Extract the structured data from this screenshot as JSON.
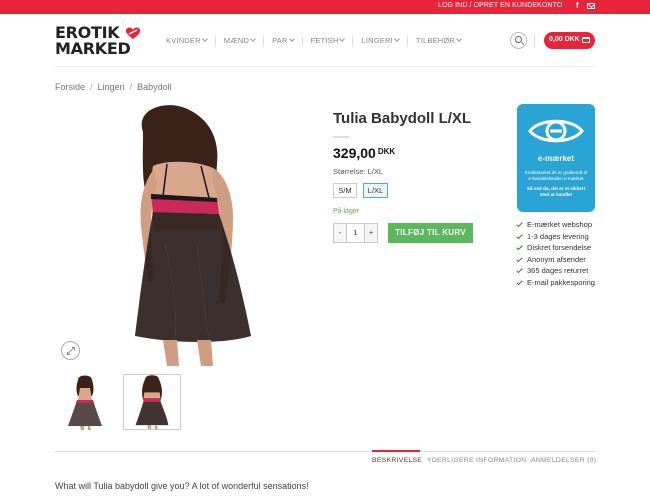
{
  "topbar": {
    "login_label": "LOG IND / OPRET EN KUNDEKONTO",
    "facebook_icon": "facebook-icon",
    "mail_icon": "mail-icon"
  },
  "header": {
    "logo_line1": "EROTIK",
    "logo_line2": "MARKED",
    "nav": [
      {
        "label": "KVINDER"
      },
      {
        "label": "MÆND"
      },
      {
        "label": "PAR"
      },
      {
        "label": "FETISH"
      },
      {
        "label": "LINGERI"
      },
      {
        "label": "TILBEHØR"
      }
    ],
    "cart_label": "0,00 DKK"
  },
  "breadcrumb": [
    "Forside",
    "Lingeri",
    "Babydoll"
  ],
  "product": {
    "title": "Tulia Babydoll L/XL",
    "price": "329,00",
    "currency": "DKK",
    "size_label": "Størrelse: L/XL",
    "sizes": [
      "S/M",
      "L/XL"
    ],
    "selected_size": "L/XL",
    "stock": "På lager",
    "qty_minus": "-",
    "quantity": "1",
    "qty_plus": "+",
    "add_to_cart": "TILFØJ TIL KURV"
  },
  "emarket": {
    "brand": "e-mærket",
    "desc": "ErotikMarket.dk er godkendt af e-handelsfonden e-mærket",
    "desc2": "Så ved du, det er et sikkert sted at handle!"
  },
  "features": [
    "E-mærket webshop",
    "1-3 dages levering",
    "Diskret forsendelse",
    "Anonym afsender",
    "365 dages returret",
    "E-mail pakkesporing"
  ],
  "tabs": [
    "BESKRIVELSE",
    "YDERLIGERE INFORMATION",
    "ANMELDELSER (0)"
  ],
  "description": "What will Tulia babydoll give you? A lot of wonderful sensations!",
  "colors": {
    "brand_red": "#e8243a",
    "cart_green": "#5cb85c",
    "emarket_blue": "#2aa4d4",
    "stock_green": "#6aa84f"
  }
}
